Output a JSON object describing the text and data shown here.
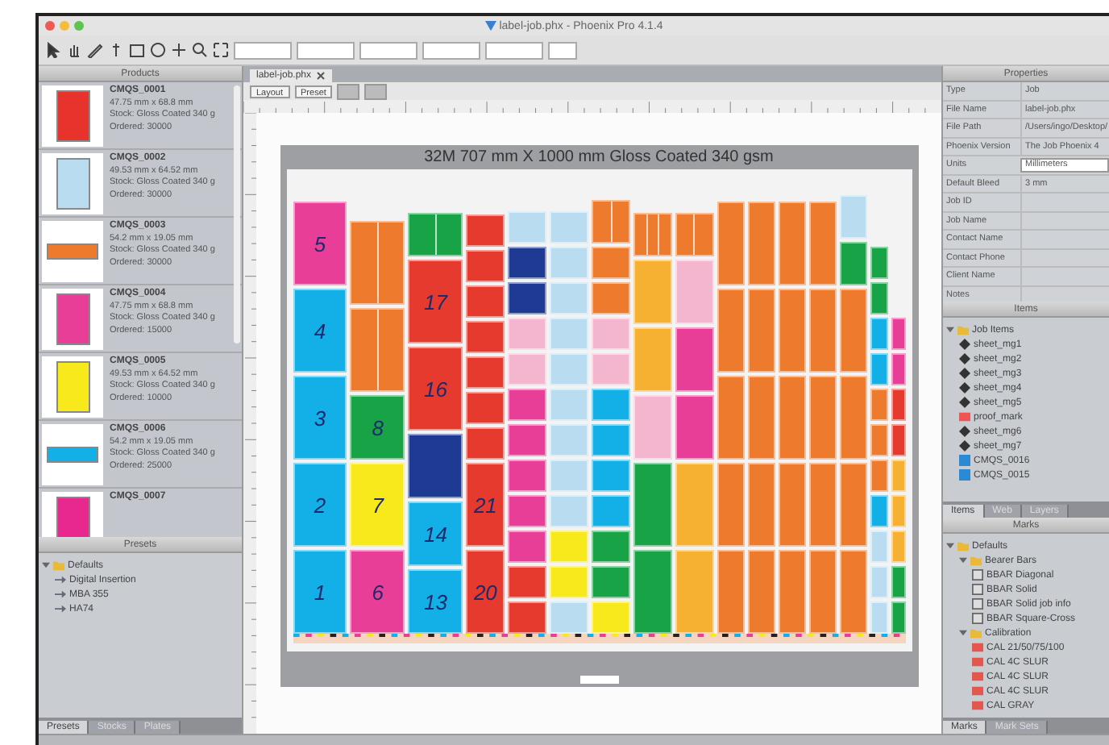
{
  "window": {
    "title": "label-job.phx - Phoenix Pro 4.1.4"
  },
  "document_tab": {
    "label": "label-job.phx"
  },
  "canvas_buttons": [
    "Layout",
    "Preset"
  ],
  "products": {
    "title": "Products",
    "items": [
      {
        "name": "CMQS_0001",
        "size": "47.75 mm x 68.8 mm",
        "stock": "Stock: Gloss Coated 340 g",
        "ordered": "Ordered: 30000",
        "color": "#e8322c",
        "kind": "tall"
      },
      {
        "name": "CMQS_0002",
        "size": "49.53 mm x 64.52 mm",
        "stock": "Stock: Gloss Coated 340 g",
        "ordered": "Ordered: 30000",
        "color": "#b9dcf0",
        "kind": "tall"
      },
      {
        "name": "CMQS_0003",
        "size": "54.2 mm x 19.05 mm",
        "stock": "Stock: Gloss Coated 340 g",
        "ordered": "Ordered: 30000",
        "color": "#ee7a2e",
        "kind": "wide"
      },
      {
        "name": "CMQS_0004",
        "size": "47.75 mm x 68.8 mm",
        "stock": "Stock: Gloss Coated 340 g",
        "ordered": "Ordered: 15000",
        "color": "#e83e97",
        "kind": "tall"
      },
      {
        "name": "CMQS_0005",
        "size": "49.53 mm x 64.52 mm",
        "stock": "Stock: Gloss Coated 340 g",
        "ordered": "Ordered: 10000",
        "color": "#f7e91c",
        "kind": "tall"
      },
      {
        "name": "CMQS_0006",
        "size": "54.2 mm x 19.05 mm",
        "stock": "Stock: Gloss Coated 340 g",
        "ordered": "Ordered: 25000",
        "color": "#12b0e6",
        "kind": "wide"
      },
      {
        "name": "CMQS_0007",
        "color": "#e8288f",
        "kind": "tall"
      }
    ]
  },
  "presets": {
    "title": "Presets",
    "tree": [
      {
        "label": "Defaults",
        "kind": "folder",
        "expanded": true,
        "children": [
          {
            "label": "Digital Insertion",
            "kind": "preset"
          },
          {
            "label": "MBA 355",
            "kind": "preset"
          },
          {
            "label": "HA74",
            "kind": "preset"
          }
        ]
      }
    ],
    "tabs": [
      {
        "label": "Presets",
        "selected": true
      },
      {
        "label": "Stocks",
        "selected": false
      },
      {
        "label": "Plates",
        "selected": false
      }
    ]
  },
  "sheet": {
    "title": "32M 707 mm X 1000 mm Gloss Coated 340 gsm",
    "columns": [
      {
        "kind": "wide",
        "tiles": [
          {
            "kind": "tall",
            "color": "#e83e97",
            "label": "5"
          },
          {
            "kind": "tall",
            "color": "#12b0e6",
            "label": "4"
          },
          {
            "kind": "tall",
            "color": "#12b0e6",
            "label": "3"
          },
          {
            "kind": "tall",
            "color": "#12b0e6",
            "label": "2"
          },
          {
            "kind": "tall",
            "color": "#12b0e6",
            "label": "1"
          }
        ]
      },
      {
        "kind": "wide",
        "tiles": [
          {
            "kind": "tallpair",
            "color": "#ee7a2e"
          },
          {
            "kind": "tallpair",
            "color": "#ee7a2e"
          },
          {
            "kind": "medium",
            "color": "#19a347",
            "label": "8"
          },
          {
            "kind": "tall",
            "color": "#f7e91c",
            "label": "7"
          },
          {
            "kind": "tall",
            "color": "#e83e97",
            "label": "6"
          }
        ]
      },
      {
        "kind": "wide",
        "tiles": [
          {
            "kind": "shortpair",
            "color": "#19a347"
          },
          {
            "kind": "tall",
            "color": "#e63a2f",
            "label": "17"
          },
          {
            "kind": "tall",
            "color": "#e63a2f",
            "label": "16"
          },
          {
            "kind": "medium",
            "color": "#1f3a93"
          },
          {
            "kind": "medium",
            "color": "#12b0e6",
            "label": "14"
          },
          {
            "kind": "medium",
            "color": "#12b0e6",
            "label": "13"
          }
        ]
      },
      {
        "kind": "medium",
        "tiles": [
          {
            "kind": "tiny",
            "color": "#e63a2f"
          },
          {
            "kind": "tiny",
            "color": "#e63a2f"
          },
          {
            "kind": "tiny",
            "color": "#e63a2f"
          },
          {
            "kind": "tiny",
            "color": "#e63a2f"
          },
          {
            "kind": "tiny",
            "color": "#e63a2f"
          },
          {
            "kind": "tiny",
            "color": "#e63a2f"
          },
          {
            "kind": "tiny",
            "color": "#e63a2f"
          },
          {
            "kind": "tall",
            "color": "#e63a2f",
            "label": "21"
          },
          {
            "kind": "tall",
            "color": "#e63a2f",
            "label": "20"
          }
        ]
      },
      {
        "kind": "medium",
        "tiles": [
          {
            "kind": "tiny",
            "color": "#b9dcf0"
          },
          {
            "kind": "tiny",
            "color": "#1f3a93"
          },
          {
            "kind": "tiny",
            "color": "#1f3a93"
          },
          {
            "kind": "tiny",
            "color": "#f4b6cf"
          },
          {
            "kind": "tiny",
            "color": "#f4b6cf"
          },
          {
            "kind": "tiny",
            "color": "#e83e97"
          },
          {
            "kind": "tiny",
            "color": "#e83e97"
          },
          {
            "kind": "tiny",
            "color": "#e83e97"
          },
          {
            "kind": "tiny",
            "color": "#e83e97"
          },
          {
            "kind": "tiny",
            "color": "#e83e97"
          },
          {
            "kind": "tiny",
            "color": "#e63a2f"
          },
          {
            "kind": "tiny",
            "color": "#e63a2f"
          }
        ]
      },
      {
        "kind": "medium",
        "tiles": [
          {
            "kind": "tiny",
            "color": "#b9dcf0"
          },
          {
            "kind": "tiny",
            "color": "#b9dcf0"
          },
          {
            "kind": "tiny",
            "color": "#b9dcf0"
          },
          {
            "kind": "tiny",
            "color": "#b9dcf0"
          },
          {
            "kind": "tiny",
            "color": "#b9dcf0"
          },
          {
            "kind": "tiny",
            "color": "#b9dcf0"
          },
          {
            "kind": "tiny",
            "color": "#b9dcf0"
          },
          {
            "kind": "tiny",
            "color": "#b9dcf0"
          },
          {
            "kind": "tiny",
            "color": "#b9dcf0"
          },
          {
            "kind": "tiny",
            "color": "#f7e91c"
          },
          {
            "kind": "tiny",
            "color": "#f7e91c"
          },
          {
            "kind": "tiny",
            "color": "#b9dcf0"
          }
        ]
      },
      {
        "kind": "medium",
        "tiles": [
          {
            "kind": "shortpair",
            "color": "#ee7a2e"
          },
          {
            "kind": "tiny",
            "color": "#ee7a2e"
          },
          {
            "kind": "tiny",
            "color": "#ee7a2e"
          },
          {
            "kind": "tiny",
            "color": "#f4b6cf"
          },
          {
            "kind": "tiny",
            "color": "#f4b6cf"
          },
          {
            "kind": "tiny",
            "color": "#12b0e6"
          },
          {
            "kind": "tiny",
            "color": "#12b0e6"
          },
          {
            "kind": "tiny",
            "color": "#12b0e6"
          },
          {
            "kind": "tiny",
            "color": "#12b0e6"
          },
          {
            "kind": "tiny",
            "color": "#19a347"
          },
          {
            "kind": "tiny",
            "color": "#19a347"
          },
          {
            "kind": "tiny",
            "color": "#f7e91c"
          }
        ]
      },
      {
        "kind": "medium",
        "tiles": [
          {
            "kind": "shorttriple",
            "color": "#ee7a2e"
          },
          {
            "kind": "medium",
            "color": "#f6b132"
          },
          {
            "kind": "medium",
            "color": "#f6b132"
          },
          {
            "kind": "medium",
            "color": "#f4b6cf"
          },
          {
            "kind": "tall",
            "color": "#19a347"
          },
          {
            "kind": "tall",
            "color": "#19a347"
          }
        ]
      },
      {
        "kind": "medium",
        "tiles": [
          {
            "kind": "shortpair",
            "color": "#ee7a2e"
          },
          {
            "kind": "medium",
            "color": "#f4b6cf"
          },
          {
            "kind": "medium",
            "color": "#e83e97"
          },
          {
            "kind": "medium",
            "color": "#e83e97"
          },
          {
            "kind": "tall",
            "color": "#f6b132"
          },
          {
            "kind": "tall",
            "color": "#f6b132"
          }
        ]
      },
      {
        "kind": "narrow",
        "tiles": [
          {
            "kind": "tall",
            "color": "#ee7a2e"
          },
          {
            "kind": "tall",
            "color": "#ee7a2e"
          },
          {
            "kind": "tall",
            "color": "#ee7a2e"
          },
          {
            "kind": "tall",
            "color": "#ee7a2e"
          },
          {
            "kind": "tall",
            "color": "#ee7a2e"
          }
        ]
      },
      {
        "kind": "narrow",
        "tiles": [
          {
            "kind": "tall",
            "color": "#ee7a2e"
          },
          {
            "kind": "tall",
            "color": "#ee7a2e"
          },
          {
            "kind": "tall",
            "color": "#ee7a2e"
          },
          {
            "kind": "tall",
            "color": "#ee7a2e"
          },
          {
            "kind": "tall",
            "color": "#ee7a2e"
          }
        ]
      },
      {
        "kind": "narrow",
        "tiles": [
          {
            "kind": "tall",
            "color": "#ee7a2e"
          },
          {
            "kind": "tall",
            "color": "#ee7a2e"
          },
          {
            "kind": "tall",
            "color": "#ee7a2e"
          },
          {
            "kind": "tall",
            "color": "#ee7a2e"
          },
          {
            "kind": "tall",
            "color": "#ee7a2e"
          }
        ]
      },
      {
        "kind": "narrow",
        "tiles": [
          {
            "kind": "tall",
            "color": "#ee7a2e"
          },
          {
            "kind": "tall",
            "color": "#ee7a2e"
          },
          {
            "kind": "tall",
            "color": "#ee7a2e"
          },
          {
            "kind": "tall",
            "color": "#ee7a2e"
          },
          {
            "kind": "tall",
            "color": "#ee7a2e"
          }
        ]
      },
      {
        "kind": "narrow",
        "tiles": [
          {
            "kind": "short",
            "color": "#b9dcf0"
          },
          {
            "kind": "short",
            "color": "#19a347"
          },
          {
            "kind": "tall",
            "color": "#ee7a2e"
          },
          {
            "kind": "tall",
            "color": "#ee7a2e"
          },
          {
            "kind": "tall",
            "color": "#ee7a2e"
          },
          {
            "kind": "tall",
            "color": "#ee7a2e"
          }
        ]
      },
      {
        "kind": "slim",
        "tiles": [
          {
            "kind": "tiny",
            "color": "#19a347"
          },
          {
            "kind": "tiny",
            "color": "#19a347"
          },
          {
            "kind": "tiny",
            "color": "#12b0e6"
          },
          {
            "kind": "tiny",
            "color": "#12b0e6"
          },
          {
            "kind": "tiny",
            "color": "#ee7a2e"
          },
          {
            "kind": "tiny",
            "color": "#ee7a2e"
          },
          {
            "kind": "tiny",
            "color": "#ee7a2e"
          },
          {
            "kind": "tiny",
            "color": "#12b0e6"
          },
          {
            "kind": "tiny",
            "color": "#b9dcf0"
          },
          {
            "kind": "tiny",
            "color": "#b9dcf0"
          },
          {
            "kind": "tiny",
            "color": "#b9dcf0"
          }
        ]
      },
      {
        "kind": "thin",
        "tiles": [
          {
            "kind": "tiny",
            "color": "#e83e97"
          },
          {
            "kind": "tiny",
            "color": "#e83e97"
          },
          {
            "kind": "tiny",
            "color": "#e63a2f"
          },
          {
            "kind": "tiny",
            "color": "#e63a2f"
          },
          {
            "kind": "tiny",
            "color": "#f6b132"
          },
          {
            "kind": "tiny",
            "color": "#f6b132"
          },
          {
            "kind": "tiny",
            "color": "#f6b132"
          },
          {
            "kind": "tiny",
            "color": "#19a347"
          },
          {
            "kind": "tiny",
            "color": "#19a347"
          }
        ]
      }
    ]
  },
  "properties": {
    "title": "Properties",
    "rows": [
      {
        "label": "Type",
        "value": "Job",
        "kind": "text"
      },
      {
        "label": "File Name",
        "value": "label-job.phx",
        "kind": "text"
      },
      {
        "label": "File Path",
        "value": "/Users/ingo/Desktop/",
        "kind": "text"
      },
      {
        "label": "Phoenix Version",
        "value": "The Job Phoenix 4",
        "kind": "text"
      },
      {
        "label": "Units",
        "value": "Millimeters",
        "kind": "field"
      },
      {
        "label": "Default Bleed",
        "value": "3 mm",
        "kind": "text"
      },
      {
        "label": "Job ID",
        "kind": "text"
      },
      {
        "label": "Job Name",
        "kind": "text"
      },
      {
        "label": "Contact Name",
        "kind": "text"
      },
      {
        "label": "Contact Phone",
        "kind": "text"
      },
      {
        "label": "Client Name",
        "kind": "text"
      },
      {
        "label": "Notes",
        "kind": "text"
      }
    ]
  },
  "items": {
    "title": "Items",
    "tree": [
      {
        "label": "Job Items",
        "kind": "folder",
        "expanded": true,
        "children": [
          {
            "label": "sheet_mg1",
            "kind": "sheet"
          },
          {
            "label": "sheet_mg2",
            "kind": "sheet"
          },
          {
            "label": "sheet_mg3",
            "kind": "sheet"
          },
          {
            "label": "sheet_mg4",
            "kind": "sheet"
          },
          {
            "label": "sheet_mg5",
            "kind": "sheet"
          },
          {
            "label": "proof_mark",
            "kind": "proof"
          },
          {
            "label": "sheet_mg6",
            "kind": "sheet"
          },
          {
            "label": "sheet_mg7",
            "kind": "sheet"
          },
          {
            "label": "CMQS_0016",
            "kind": "product"
          },
          {
            "label": "CMQS_0015",
            "kind": "product"
          }
        ]
      }
    ],
    "tabs": [
      {
        "label": "Items",
        "selected": true
      },
      {
        "label": "Web",
        "selected": false
      },
      {
        "label": "Layers",
        "selected": false
      }
    ]
  },
  "marks": {
    "title": "Marks",
    "tree": [
      {
        "label": "Defaults",
        "kind": "folder",
        "expanded": true,
        "children": [
          {
            "label": "Bearer Bars",
            "kind": "folder",
            "expanded": true,
            "children": [
              {
                "label": "BBAR Diagonal",
                "kind": "mark"
              },
              {
                "label": "BBAR Solid",
                "kind": "mark"
              },
              {
                "label": "BBAR Solid job info",
                "kind": "mark"
              },
              {
                "label": "BBAR Square-Cross",
                "kind": "mark"
              }
            ]
          },
          {
            "label": "Calibration",
            "kind": "folder",
            "expanded": true,
            "children": [
              {
                "label": "CAL 21/50/75/100",
                "kind": "calibration"
              },
              {
                "label": "CAL 4C SLUR",
                "kind": "calibration"
              },
              {
                "label": "CAL 4C SLUR",
                "kind": "calibration"
              },
              {
                "label": "CAL 4C SLUR",
                "kind": "calibration"
              },
              {
                "label": "CAL GRAY",
                "kind": "calibration"
              }
            ]
          }
        ]
      }
    ],
    "tabs": [
      {
        "label": "Marks",
        "selected": true
      },
      {
        "label": "Mark Sets",
        "selected": false
      }
    ]
  }
}
